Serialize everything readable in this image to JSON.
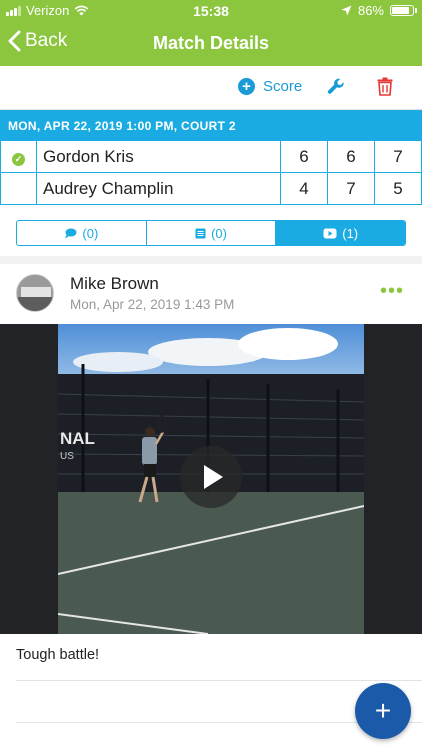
{
  "status_bar": {
    "carrier": "Verizon",
    "time": "15:38",
    "battery": "86%",
    "battery_level": 0.86
  },
  "nav": {
    "back_label": "Back",
    "title": "Match Details"
  },
  "toolbar": {
    "score_label": "Score",
    "icons": [
      "plus-circle-icon",
      "wrench-icon",
      "trash-icon"
    ]
  },
  "match": {
    "header": "MON, APR 22, 2019 1:00 PM, COURT 2",
    "players": [
      {
        "name": "Gordon Kris",
        "winner": true,
        "sets": [
          "6",
          "6",
          "7"
        ]
      },
      {
        "name": "Audrey Champlin",
        "winner": false,
        "sets": [
          "4",
          "7",
          "5"
        ]
      }
    ]
  },
  "tabs": [
    {
      "icon": "comments-icon",
      "label": "(0)",
      "active": false
    },
    {
      "icon": "list-icon",
      "label": "(0)",
      "active": false
    },
    {
      "icon": "video-icon",
      "label": "(1)",
      "active": true
    }
  ],
  "post": {
    "author": "Mike Brown",
    "time": "Mon, Apr 22, 2019 1:43 PM",
    "more_label": "•••",
    "caption": "Tough battle!"
  },
  "fab": {
    "label": "+"
  },
  "colors": {
    "header_green": "#8cc63f",
    "accent_blue": "#1aabe2",
    "fab_blue": "#1a5aa8",
    "delete_red": "#e53935"
  }
}
